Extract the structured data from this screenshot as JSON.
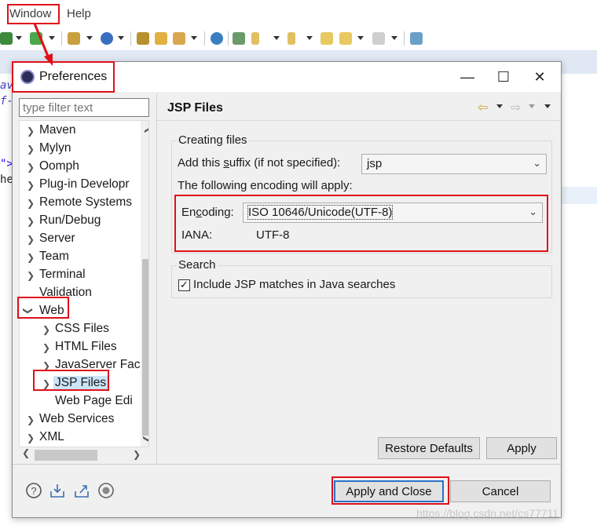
{
  "menubar": {
    "window": "Window",
    "help": "Help"
  },
  "editor": {
    "frag1": "av",
    "frag2": "f-",
    "frag3": "\">",
    "frag4": "he"
  },
  "dialog": {
    "title": "Preferences",
    "minimize": "—",
    "maximize": "☐",
    "close": "✕",
    "filter_placeholder": "type filter text",
    "tree": [
      {
        "label": "Maven",
        "state": "collapsed"
      },
      {
        "label": "Mylyn",
        "state": "collapsed"
      },
      {
        "label": "Oomph",
        "state": "collapsed"
      },
      {
        "label": "Plug-in Developr",
        "state": "collapsed"
      },
      {
        "label": "Remote Systems",
        "state": "collapsed"
      },
      {
        "label": "Run/Debug",
        "state": "collapsed"
      },
      {
        "label": "Server",
        "state": "collapsed"
      },
      {
        "label": "Team",
        "state": "collapsed"
      },
      {
        "label": "Terminal",
        "state": "collapsed"
      },
      {
        "label": "Validation",
        "state": "leaf"
      },
      {
        "label": "Web",
        "state": "expanded"
      },
      {
        "label": "CSS Files",
        "state": "collapsed"
      },
      {
        "label": "HTML Files",
        "state": "collapsed"
      },
      {
        "label": "JavaServer Fac",
        "state": "collapsed"
      },
      {
        "label": "JSP Files",
        "state": "collapsed",
        "selected": true
      },
      {
        "label": "Web Page Edi",
        "state": "leaf"
      },
      {
        "label": "Web Services",
        "state": "collapsed"
      },
      {
        "label": "XML",
        "state": "collapsed"
      }
    ],
    "page": {
      "title": "JSP Files",
      "creating_files": {
        "group": "Creating files",
        "suffix_label_pre": "Add this ",
        "suffix_label_u": "s",
        "suffix_label_post": "uffix (if not specified):",
        "suffix_value": "jsp",
        "encoding_note": "The following encoding will apply:",
        "encoding_label_pre": "En",
        "encoding_label_u": "c",
        "encoding_label_post": "oding:",
        "encoding_value": "ISO 10646/Unicode(UTF-8)",
        "iana_label": "IANA:",
        "iana_value": "UTF-8"
      },
      "search": {
        "group": "Search",
        "include_label": "Include JSP matches in Java searches",
        "include_checked": true
      },
      "restore_defaults": "Restore Defaults",
      "apply": "Apply"
    },
    "apply_and_close": "Apply and Close",
    "cancel": "Cancel"
  },
  "watermark": "https://blog.csdn.net/cs77711",
  "colors": {
    "annotation_red": "#e0101a",
    "default_button_border": "#2a72c7"
  }
}
